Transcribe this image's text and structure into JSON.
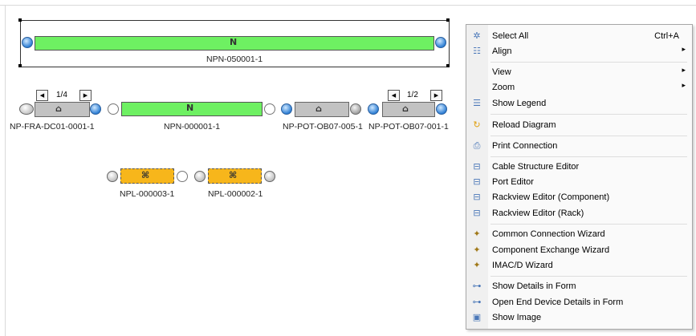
{
  "diagram": {
    "top_node": {
      "label": "NPN-050001-1",
      "icon": "N"
    },
    "row1": {
      "left_pager": {
        "page": "1/4"
      },
      "right_pager": {
        "page": "1/2"
      },
      "left_node": {
        "label": "NP-FRA-DC01-0001-1"
      },
      "center_node": {
        "label": "NPN-000001-1",
        "icon": "N"
      },
      "mid_right_node": {
        "label": "NP-POT-OB07-005-1"
      },
      "far_right_node": {
        "label": "NP-POT-OB07-001-1"
      }
    },
    "row2": {
      "left_node": {
        "label": "NPL-000003-1"
      },
      "right_node": {
        "label": "NPL-000002-1"
      }
    }
  },
  "context_menu": {
    "items": [
      {
        "label": "Select All",
        "shortcut": "Ctrl+A",
        "icon": "select-all-icon",
        "glyph": "✲"
      },
      {
        "label": "Align",
        "submenu": "▸",
        "icon": "align-icon",
        "glyph": "☷"
      },
      {
        "label": "View",
        "submenu": "▸"
      },
      {
        "label": "Zoom",
        "submenu": "▸"
      },
      {
        "label": "Show Legend",
        "icon": "legend-icon",
        "glyph": "☰"
      },
      {
        "label": "Reload Diagram",
        "icon": "reload-icon",
        "glyph": "↻"
      },
      {
        "label": "Print Connection",
        "icon": "print-icon",
        "glyph": "⎙"
      },
      {
        "label": "Cable Structure Editor",
        "icon": "editor-icon",
        "glyph": "⊟"
      },
      {
        "label": "Port Editor",
        "icon": "editor-icon",
        "glyph": "⊟"
      },
      {
        "label": "Rackview Editor (Component)",
        "icon": "editor-icon",
        "glyph": "⊟"
      },
      {
        "label": "Rackview Editor (Rack)",
        "icon": "editor-icon",
        "glyph": "⊟"
      },
      {
        "label": "Common Connection Wizard",
        "icon": "wizard-wand-icon",
        "glyph": "✦"
      },
      {
        "label": "Component Exchange Wizard",
        "icon": "wizard-wand-icon",
        "glyph": "✦"
      },
      {
        "label": "IMAC/D Wizard",
        "icon": "wizard-wand-icon",
        "glyph": "✦"
      },
      {
        "label": "Show Details in Form",
        "icon": "form-details-icon",
        "glyph": "⊶"
      },
      {
        "label": "Open End Device Details in Form",
        "icon": "form-details-icon",
        "glyph": "⊶"
      },
      {
        "label": "Show Image",
        "icon": "image-icon",
        "glyph": "▣"
      }
    ]
  },
  "colors": {
    "link_green": "#6ef062",
    "device_gray": "#c2c2c2",
    "node_orange": "#f7b61b",
    "menu_bg": "#fafafa"
  }
}
